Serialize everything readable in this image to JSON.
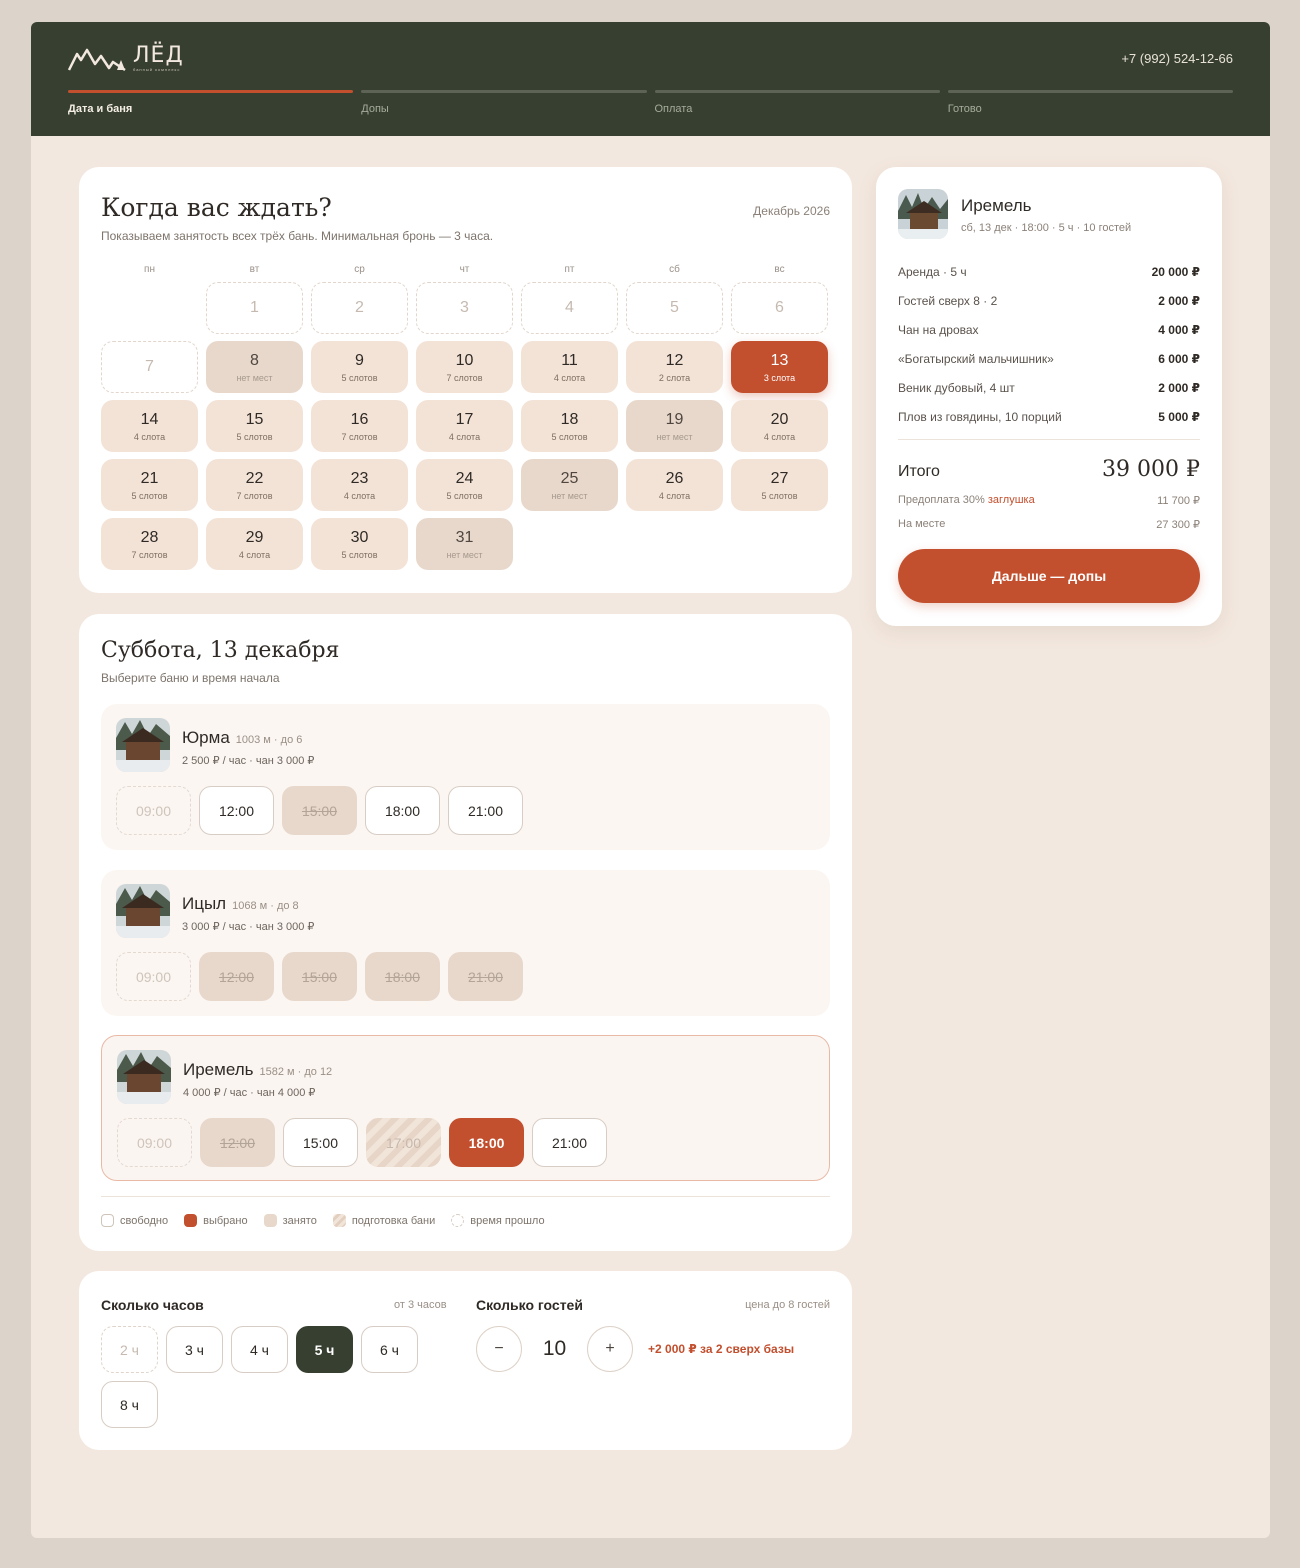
{
  "header": {
    "logo_text": "ЛЁД",
    "logo_sub": "банный комплекс",
    "phone": "+7 (992) 524-12-66",
    "steps": [
      {
        "label": "Дата и баня",
        "active": true
      },
      {
        "label": "Допы",
        "active": false
      },
      {
        "label": "Оплата",
        "active": false
      },
      {
        "label": "Готово",
        "active": false
      }
    ]
  },
  "calendar": {
    "title": "Когда вас ждать?",
    "subtitle": "Показываем занятость всех трёх бань. Минимальная бронь — 3 часа.",
    "month": "Декабрь 2026",
    "weekdays": [
      "пн",
      "вт",
      "ср",
      "чт",
      "пт",
      "сб",
      "вс"
    ],
    "days": [
      {
        "n": "",
        "s": "",
        "state": "empty"
      },
      {
        "n": "1",
        "s": "",
        "state": "past"
      },
      {
        "n": "2",
        "s": "",
        "state": "past"
      },
      {
        "n": "3",
        "s": "",
        "state": "past"
      },
      {
        "n": "4",
        "s": "",
        "state": "past"
      },
      {
        "n": "5",
        "s": "",
        "state": "past"
      },
      {
        "n": "6",
        "s": "",
        "state": "past"
      },
      {
        "n": "7",
        "s": "",
        "state": "past"
      },
      {
        "n": "8",
        "s": "нет мест",
        "state": "full"
      },
      {
        "n": "9",
        "s": "5 слотов",
        "state": "open"
      },
      {
        "n": "10",
        "s": "7 слотов",
        "state": "open"
      },
      {
        "n": "11",
        "s": "4 слота",
        "state": "open"
      },
      {
        "n": "12",
        "s": "2 слота",
        "state": "open"
      },
      {
        "n": "13",
        "s": "3 слота",
        "state": "sel"
      },
      {
        "n": "14",
        "s": "4 слота",
        "state": "open"
      },
      {
        "n": "15",
        "s": "5 слотов",
        "state": "open"
      },
      {
        "n": "16",
        "s": "7 слотов",
        "state": "open"
      },
      {
        "n": "17",
        "s": "4 слота",
        "state": "open"
      },
      {
        "n": "18",
        "s": "5 слотов",
        "state": "open"
      },
      {
        "n": "19",
        "s": "нет мест",
        "state": "full"
      },
      {
        "n": "20",
        "s": "4 слота",
        "state": "open"
      },
      {
        "n": "21",
        "s": "5 слотов",
        "state": "open"
      },
      {
        "n": "22",
        "s": "7 слотов",
        "state": "open"
      },
      {
        "n": "23",
        "s": "4 слота",
        "state": "open"
      },
      {
        "n": "24",
        "s": "5 слотов",
        "state": "open"
      },
      {
        "n": "25",
        "s": "нет мест",
        "state": "full"
      },
      {
        "n": "26",
        "s": "4 слота",
        "state": "open"
      },
      {
        "n": "27",
        "s": "5 слотов",
        "state": "open"
      },
      {
        "n": "28",
        "s": "7 слотов",
        "state": "open"
      },
      {
        "n": "29",
        "s": "4 слота",
        "state": "open"
      },
      {
        "n": "30",
        "s": "5 слотов",
        "state": "open"
      },
      {
        "n": "31",
        "s": "нет мест",
        "state": "full"
      }
    ]
  },
  "slots": {
    "title": "Суббота, 13 декабря",
    "subtitle": "Выберите баню и время начала",
    "baths": [
      {
        "name": "Юрма",
        "meta": "1003 м · до 6",
        "price": "2 500 ₽ / час · чан 3 000 ₽",
        "selected": false,
        "times": [
          {
            "t": "09:00",
            "state": "past"
          },
          {
            "t": "12:00",
            "state": "free"
          },
          {
            "t": "15:00",
            "state": "busy"
          },
          {
            "t": "18:00",
            "state": "free"
          },
          {
            "t": "21:00",
            "state": "free"
          }
        ]
      },
      {
        "name": "Ицыл",
        "meta": "1068 м · до 8",
        "price": "3 000 ₽ / час · чан 3 000 ₽",
        "selected": false,
        "times": [
          {
            "t": "09:00",
            "state": "past"
          },
          {
            "t": "12:00",
            "state": "busy"
          },
          {
            "t": "15:00",
            "state": "busy"
          },
          {
            "t": "18:00",
            "state": "busy"
          },
          {
            "t": "21:00",
            "state": "busy"
          }
        ]
      },
      {
        "name": "Иремель",
        "meta": "1582 м · до 12",
        "price": "4 000 ₽ / час · чан 4 000 ₽",
        "selected": true,
        "times": [
          {
            "t": "09:00",
            "state": "past"
          },
          {
            "t": "12:00",
            "state": "busy"
          },
          {
            "t": "15:00",
            "state": "free"
          },
          {
            "t": "17:00",
            "state": "prep"
          },
          {
            "t": "18:00",
            "state": "chosen"
          },
          {
            "t": "21:00",
            "state": "free"
          }
        ]
      }
    ],
    "legend": [
      "свободно",
      "выбрано",
      "занято",
      "подготовка бани",
      "время прошло"
    ]
  },
  "hours": {
    "label": "Сколько часов",
    "hint": "от 3 часов",
    "options": [
      {
        "v": "2 ч",
        "state": "dis"
      },
      {
        "v": "3 ч",
        "state": "free"
      },
      {
        "v": "4 ч",
        "state": "free"
      },
      {
        "v": "5 ч",
        "state": "on"
      },
      {
        "v": "6 ч",
        "state": "free"
      },
      {
        "v": "8 ч",
        "state": "free"
      }
    ]
  },
  "guests": {
    "label": "Сколько гостей",
    "hint": "цена до 8 гостей",
    "minus": "−",
    "plus": "+",
    "value": "10",
    "extra": "+2 000 ₽ за 2 сверх базы"
  },
  "summary": {
    "name": "Иремель",
    "meta": "сб, 13 дек · 18:00 · 5 ч · 10 гостей",
    "lines": [
      {
        "label": "Аренда · 5 ч",
        "value": "20 000 ₽"
      },
      {
        "label": "Гостей сверх 8 · 2",
        "value": "2 000 ₽"
      },
      {
        "label": "Чан на дровах",
        "value": "4 000 ₽"
      },
      {
        "label": "«Богатырский мальчишник»",
        "value": "6 000 ₽"
      },
      {
        "label": "Веник дубовый, 4 шт",
        "value": "2 000 ₽"
      },
      {
        "label": "Плов из говядины, 10 порций",
        "value": "5 000 ₽"
      }
    ],
    "total_label": "Итого",
    "total_value": "39 000 ₽",
    "prepay_label": "Предоплата 30%",
    "prepay_stub": "заглушка",
    "prepay_value": "11 700 ₽",
    "onsite_label": "На месте",
    "onsite_value": "27 300 ₽",
    "next_button": "Дальше — допы"
  },
  "colors": {
    "accent": "#c24f2e",
    "header": "#374030",
    "background": "#f3e8df"
  }
}
